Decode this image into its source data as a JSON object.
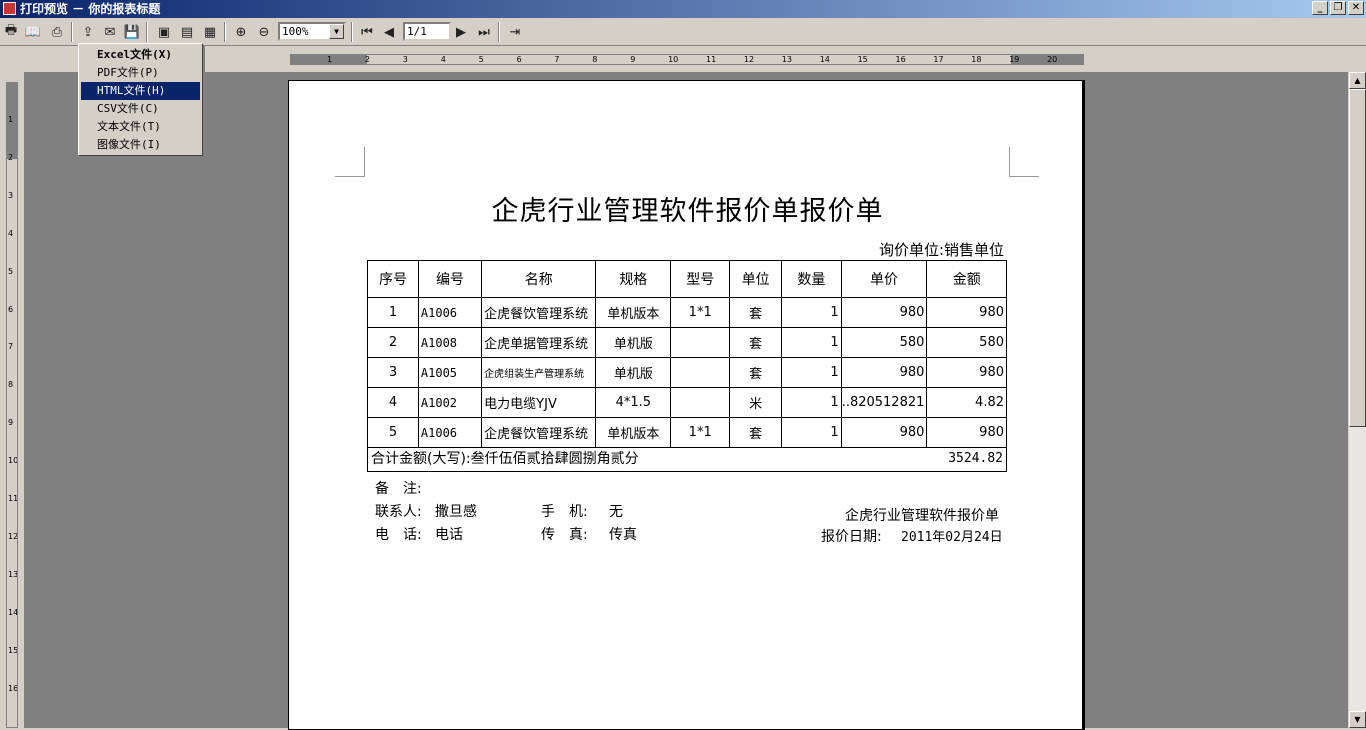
{
  "window": {
    "title": "打印预览 － 你的报表标题",
    "min": "_",
    "restore": "❐",
    "close": "✕"
  },
  "toolbar": {
    "icons": [
      "print-icon",
      "open-book-icon",
      "printer-setup-icon",
      "export-icon",
      "mail-icon",
      "save-icon",
      "save-disk-icon",
      "page-icon",
      "multipage-icon",
      "zoom-in-icon",
      "zoom-out-icon",
      "first-page-icon",
      "prev-page-icon",
      "next-page-icon",
      "last-page-icon",
      "exit-icon"
    ],
    "zoom_value": "100%",
    "page_value": "1/1"
  },
  "export_menu": {
    "items": [
      {
        "label": "Excel文件(X)",
        "bold": true,
        "selected": false
      },
      {
        "label": "PDF文件(P)",
        "bold": false,
        "selected": false
      },
      {
        "label": "HTML文件(H)",
        "bold": false,
        "selected": true
      },
      {
        "label": "CSV文件(C)",
        "bold": false,
        "selected": false
      },
      {
        "label": "文本文件(T)",
        "bold": false,
        "selected": false
      },
      {
        "label": "图像文件(I)",
        "bold": false,
        "selected": false
      }
    ]
  },
  "ruler": {
    "h_ticks": [
      "1",
      "2",
      "3",
      "4",
      "5",
      "6",
      "7",
      "8",
      "9",
      "10",
      "11",
      "12",
      "13",
      "14",
      "15",
      "16",
      "17",
      "18",
      "19",
      "20"
    ],
    "v_ticks": [
      "1",
      "2",
      "3",
      "4",
      "5",
      "6",
      "7",
      "8",
      "9",
      "10",
      "11",
      "12",
      "13",
      "14",
      "15",
      "16"
    ]
  },
  "document": {
    "title": "企虎行业管理软件报价单报价单",
    "inquiry": "询价单位:销售单位",
    "headers": [
      "序号",
      "编号",
      "名称",
      "规格",
      "型号",
      "单位",
      "数量",
      "单价",
      "金额"
    ],
    "rows": [
      [
        "1",
        "A1006",
        "企虎餐饮管理系统",
        "单机版本",
        "1*1",
        "套",
        "1",
        "980",
        "980"
      ],
      [
        "2",
        "A1008",
        "企虎单据管理系统",
        "单机版",
        "",
        "套",
        "1",
        "580",
        "580"
      ],
      [
        "3",
        "A1005",
        "企虎组装生产管理系统",
        "单机版",
        "",
        "套",
        "1",
        "980",
        "980"
      ],
      [
        "4",
        "A1002",
        "电力电缆YJV",
        "4*1.5",
        "",
        "米",
        "1",
        "..820512821",
        "4.82"
      ],
      [
        "5",
        "A1006",
        "企虎餐饮管理系统",
        "单机版本",
        "1*1",
        "套",
        "1",
        "980",
        "980"
      ]
    ],
    "total_label": "合计金额(大写):叁仟伍佰贰拾肆圆捌角贰分",
    "total_value": "3524.82",
    "remark_label": "备　注:",
    "contact_label": "联系人:",
    "contact_value": "撒旦感",
    "mobile_label": "手　机:",
    "mobile_value": "无",
    "phone_label": "电　话:",
    "phone_value": "电话",
    "fax_label": "传　真:",
    "fax_value": "传真",
    "company": "企虎行业管理软件报价单",
    "date_label": "报价日期:",
    "date_value": "2011年02月24日"
  }
}
